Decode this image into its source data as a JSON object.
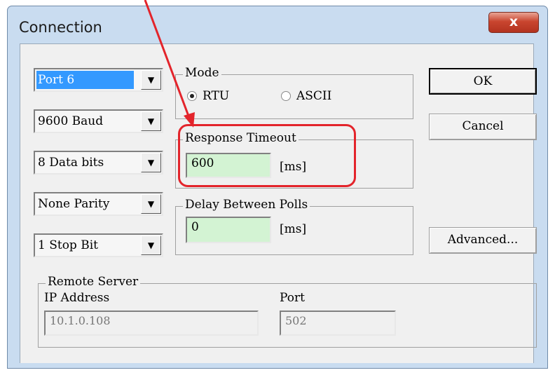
{
  "window": {
    "title": "Connection",
    "close_glyph": "x"
  },
  "combos": [
    {
      "name": "port-combo",
      "value": "Port 6",
      "selected": true
    },
    {
      "name": "baud-combo",
      "value": "9600 Baud"
    },
    {
      "name": "data-bits-combo",
      "value": "8 Data bits"
    },
    {
      "name": "parity-combo",
      "value": "None Parity"
    },
    {
      "name": "stop-bit-combo",
      "value": "1 Stop Bit"
    }
  ],
  "mode": {
    "legend": "Mode",
    "options": [
      "RTU",
      "ASCII"
    ],
    "selected": "RTU"
  },
  "response_timeout": {
    "legend": "Response Timeout",
    "value": "600",
    "unit": "[ms]"
  },
  "delay_polls": {
    "legend": "Delay Between Polls",
    "value": "0",
    "unit": "[ms]"
  },
  "buttons": {
    "ok": "OK",
    "cancel": "Cancel",
    "advanced": "Advanced..."
  },
  "remote_server": {
    "legend": "Remote Server",
    "ip_label": "IP Address",
    "ip_value": "10.1.0.108",
    "port_label": "Port",
    "port_value": "502"
  },
  "colors": {
    "annotation": "#e3242b",
    "field_bg": "#d3f3d3",
    "selection": "#3399ff"
  }
}
